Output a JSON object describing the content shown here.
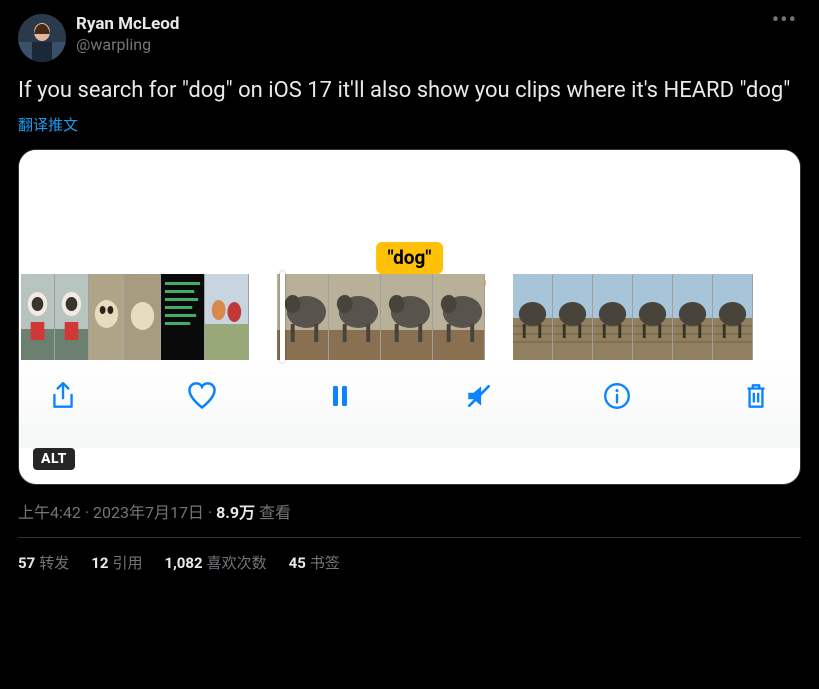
{
  "author": {
    "display_name": "Ryan McLeod",
    "handle": "@warpling"
  },
  "tweet_text": "If you search for \"dog\" on iOS 17 it'll also show you clips where it's HEARD \"dog\"",
  "translate_label": "翻译推文",
  "media": {
    "caption_pill": "\"dog\"",
    "alt_badge": "ALT"
  },
  "meta": {
    "time": "上午4:42",
    "sep1": " · ",
    "date": "2023年7月17日",
    "sep2": " · ",
    "views_num": "8.9万",
    "views_label": " 查看"
  },
  "stats": {
    "retweets_num": "57",
    "retweets_label": "转发",
    "quotes_num": "12",
    "quotes_label": "引用",
    "likes_num": "1,082",
    "likes_label": "喜欢次数",
    "bookmarks_num": "45",
    "bookmarks_label": "书签"
  }
}
